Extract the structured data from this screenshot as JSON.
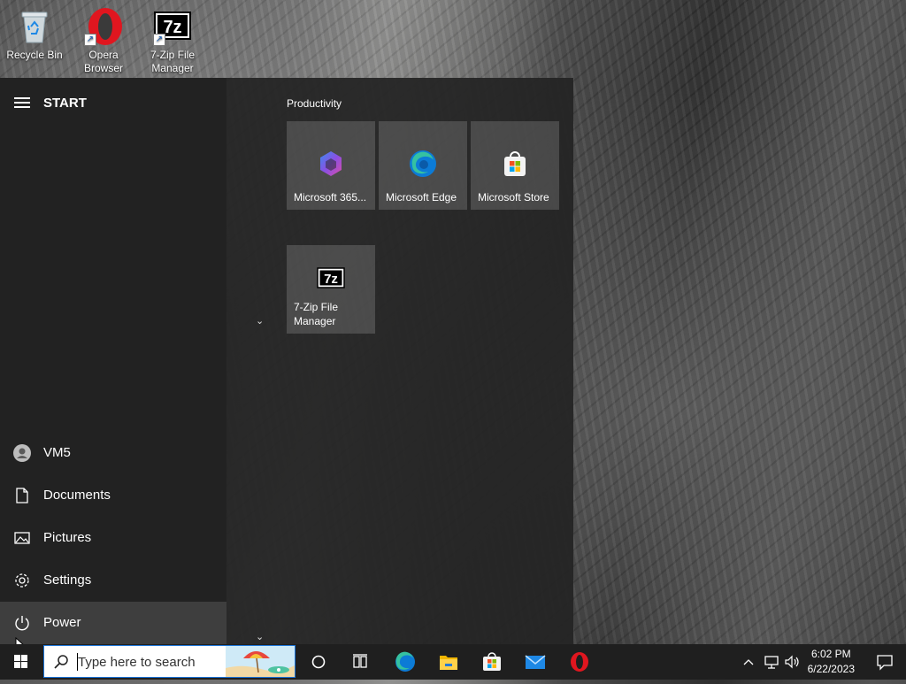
{
  "desktop": {
    "icons": [
      {
        "label": "Recycle Bin"
      },
      {
        "label": "Opera Browser"
      },
      {
        "label": "7-Zip File Manager"
      }
    ]
  },
  "start_menu": {
    "title": "START",
    "group_title": "Productivity",
    "tiles": [
      {
        "label": "Microsoft 365...",
        "icon": "microsoft-365-icon"
      },
      {
        "label": "Microsoft Edge",
        "icon": "edge-icon"
      },
      {
        "label": "Microsoft Store",
        "icon": "store-icon"
      },
      {
        "label": "7-Zip File Manager",
        "icon": "7zip-icon"
      }
    ],
    "rail": [
      {
        "label": "VM5",
        "icon": "user-icon"
      },
      {
        "label": "Documents",
        "icon": "document-icon"
      },
      {
        "label": "Pictures",
        "icon": "pictures-icon"
      },
      {
        "label": "Settings",
        "icon": "gear-icon"
      },
      {
        "label": "Power",
        "icon": "power-icon"
      }
    ]
  },
  "taskbar": {
    "search_placeholder": "Type here to search",
    "time": "6:02 PM",
    "date": "6/22/2023",
    "apps": [
      "cortana-icon",
      "task-view-icon",
      "edge-icon",
      "file-explorer-icon",
      "store-icon",
      "mail-icon",
      "opera-icon"
    ]
  },
  "colors": {
    "accent": "#1a73d8",
    "opera_red": "#e0161f",
    "start_bg": "#242424",
    "taskbar_bg": "#1f1f1f"
  }
}
